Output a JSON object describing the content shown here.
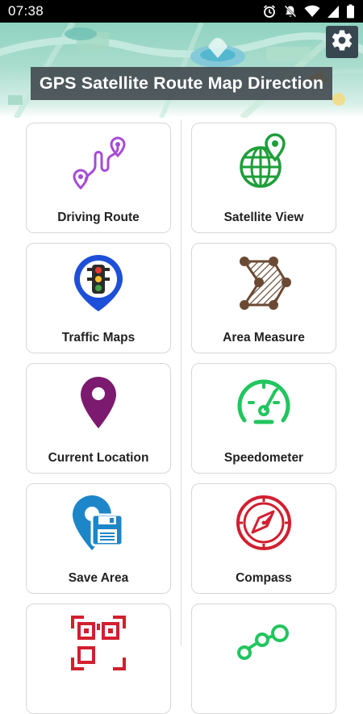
{
  "status_bar": {
    "time": "07:38",
    "icons": [
      "alarm-icon",
      "notifications-off-icon",
      "wifi-icon",
      "signal-icon",
      "battery-icon"
    ]
  },
  "header": {
    "title": "GPS Satellite Route Map Direction",
    "settings_icon": "gear-icon"
  },
  "menu": {
    "items": [
      {
        "label": "Driving Route",
        "icon": "route-pins-icon",
        "color": "#a64bd6"
      },
      {
        "label": "Satellite View",
        "icon": "globe-pin-icon",
        "color": "#1e9e3a"
      },
      {
        "label": "Traffic Maps",
        "icon": "traffic-light-pin-icon",
        "color": "#1e4fd9"
      },
      {
        "label": "Area Measure",
        "icon": "polygon-area-icon",
        "color": "#6b4a34"
      },
      {
        "label": "Current Location",
        "icon": "location-pin-icon",
        "color": "#7b1a6e"
      },
      {
        "label": "Speedometer",
        "icon": "speedometer-icon",
        "color": "#22c55e"
      },
      {
        "label": "Save Area",
        "icon": "save-pin-icon",
        "color": "#1c86c8"
      },
      {
        "label": "Compass",
        "icon": "compass-icon",
        "color": "#d21f2f"
      },
      {
        "label": "",
        "icon": "qr-code-icon",
        "color": "#d21f2f"
      },
      {
        "label": "",
        "icon": "share-nodes-icon",
        "color": "#22c55e"
      }
    ]
  }
}
